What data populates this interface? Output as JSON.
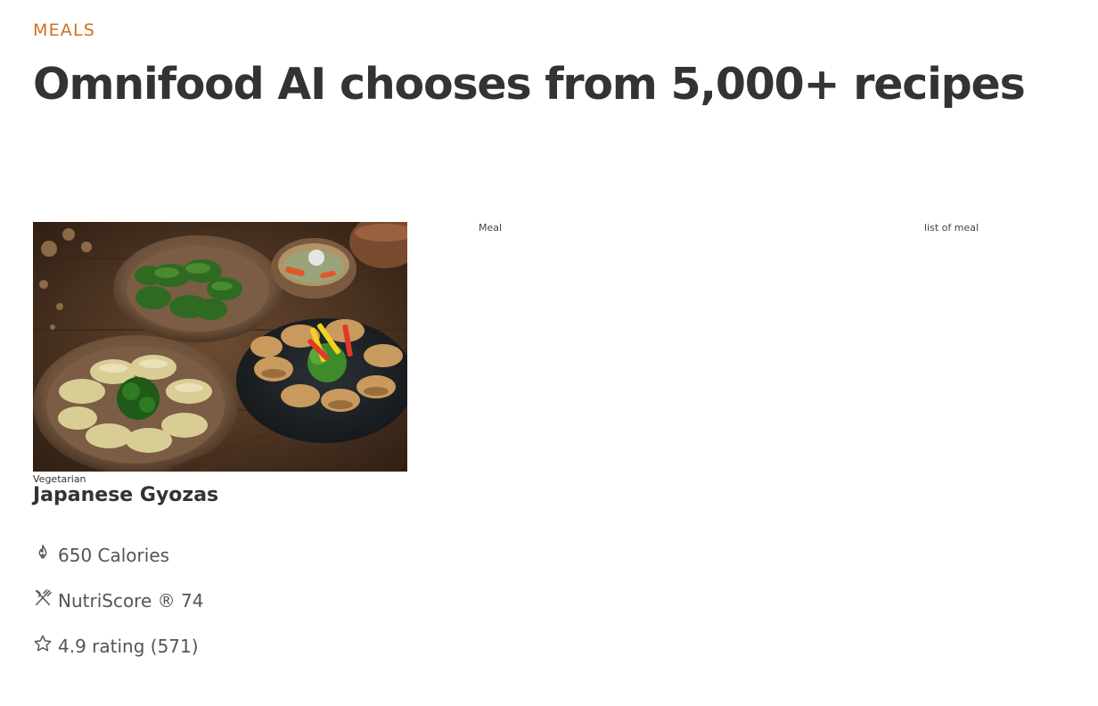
{
  "section": {
    "subheading": "MEALS",
    "heading": "Omnifood AI chooses from 5,000+ recipes"
  },
  "meal": {
    "image_subject": "Japanese gyoza dumplings on plates with greens and soup",
    "tag": "Vegetarian",
    "title": "Japanese Gyozas",
    "attributes": [
      {
        "icon": "flame-icon",
        "text": "650 Calories"
      },
      {
        "icon": "restaurant-icon",
        "text": "NutriScore ® 74"
      },
      {
        "icon": "star-icon",
        "text": "4.9 rating (571)"
      }
    ]
  },
  "broken_images": {
    "meal_alt": "Meal",
    "list_alt": "list of meal"
  },
  "colors": {
    "accent": "#cf711f",
    "text": "#333333",
    "attribute_text": "#555555",
    "background": "#ffffff"
  }
}
